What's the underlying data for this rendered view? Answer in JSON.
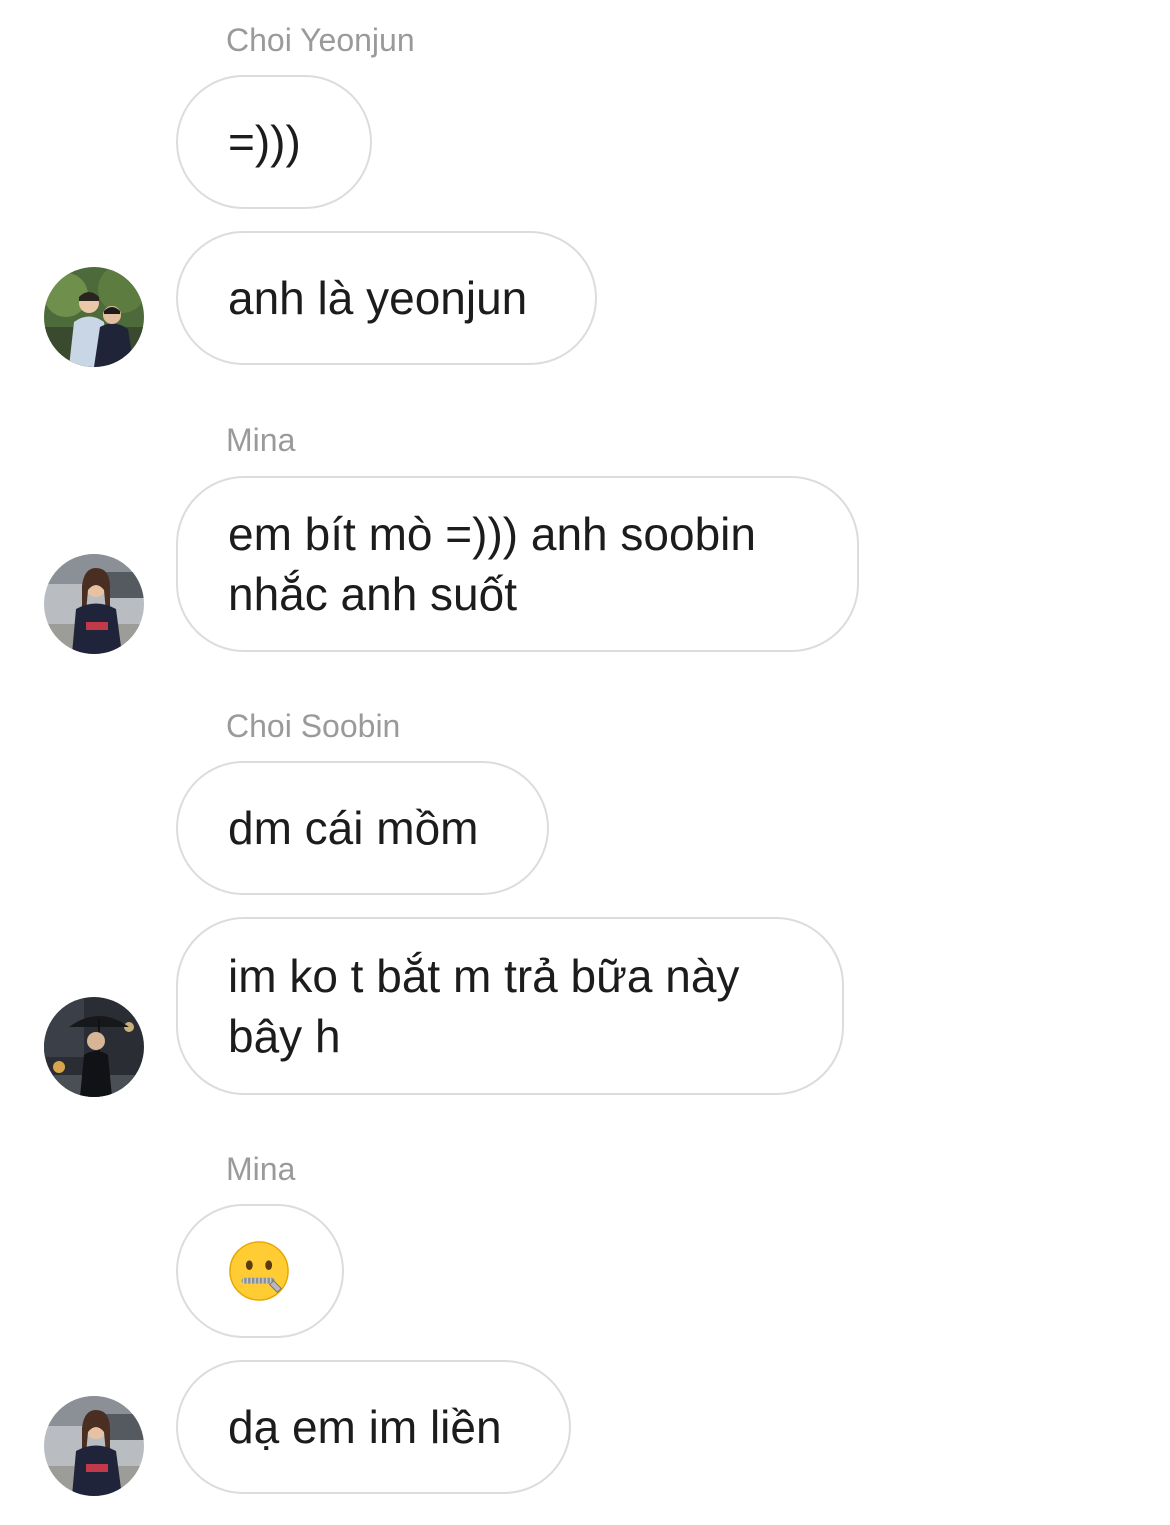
{
  "messages": [
    {
      "sender": "Choi Yeonjun",
      "texts": [
        "=)))",
        "anh là yeonjun"
      ]
    },
    {
      "sender": "Mina",
      "texts": [
        "em bít mò =))) anh soobin nhắc anh suốt"
      ]
    },
    {
      "sender": "Choi Soobin",
      "texts": [
        "dm cái mồm",
        "im ko t bắt m trả bữa này bây h"
      ]
    },
    {
      "sender": "Mina",
      "texts": [
        "🤐",
        "dạ em im liền"
      ]
    }
  ],
  "colors": {
    "bubble_border": "#dcdcdc",
    "sender_name": "#9a9a9a",
    "text": "#1c1c1c",
    "background": "#ffffff"
  },
  "icons": {
    "emoji": "zipper-mouth-face-emoji"
  }
}
